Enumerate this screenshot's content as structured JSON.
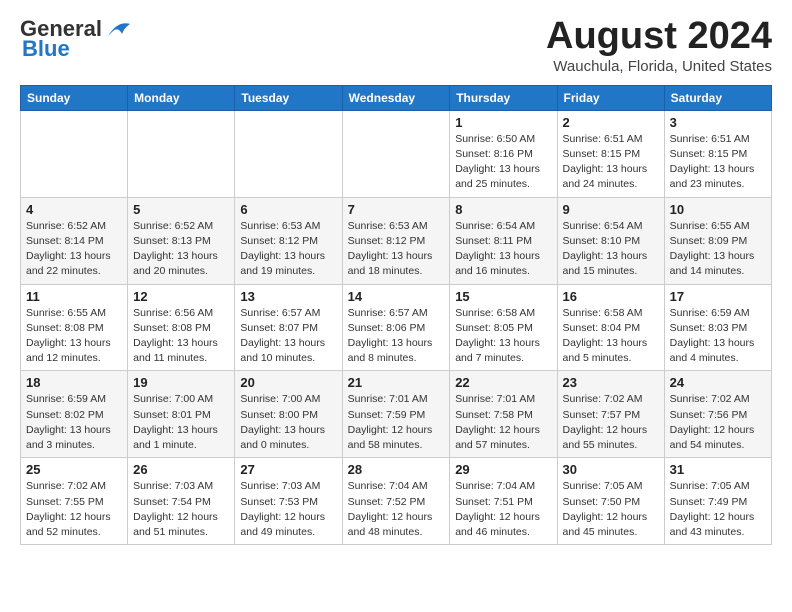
{
  "header": {
    "logo_general": "General",
    "logo_blue": "Blue",
    "month": "August 2024",
    "location": "Wauchula, Florida, United States"
  },
  "weekdays": [
    "Sunday",
    "Monday",
    "Tuesday",
    "Wednesday",
    "Thursday",
    "Friday",
    "Saturday"
  ],
  "weeks": [
    [
      {
        "day": "",
        "detail": ""
      },
      {
        "day": "",
        "detail": ""
      },
      {
        "day": "",
        "detail": ""
      },
      {
        "day": "",
        "detail": ""
      },
      {
        "day": "1",
        "detail": "Sunrise: 6:50 AM\nSunset: 8:16 PM\nDaylight: 13 hours\nand 25 minutes."
      },
      {
        "day": "2",
        "detail": "Sunrise: 6:51 AM\nSunset: 8:15 PM\nDaylight: 13 hours\nand 24 minutes."
      },
      {
        "day": "3",
        "detail": "Sunrise: 6:51 AM\nSunset: 8:15 PM\nDaylight: 13 hours\nand 23 minutes."
      }
    ],
    [
      {
        "day": "4",
        "detail": "Sunrise: 6:52 AM\nSunset: 8:14 PM\nDaylight: 13 hours\nand 22 minutes."
      },
      {
        "day": "5",
        "detail": "Sunrise: 6:52 AM\nSunset: 8:13 PM\nDaylight: 13 hours\nand 20 minutes."
      },
      {
        "day": "6",
        "detail": "Sunrise: 6:53 AM\nSunset: 8:12 PM\nDaylight: 13 hours\nand 19 minutes."
      },
      {
        "day": "7",
        "detail": "Sunrise: 6:53 AM\nSunset: 8:12 PM\nDaylight: 13 hours\nand 18 minutes."
      },
      {
        "day": "8",
        "detail": "Sunrise: 6:54 AM\nSunset: 8:11 PM\nDaylight: 13 hours\nand 16 minutes."
      },
      {
        "day": "9",
        "detail": "Sunrise: 6:54 AM\nSunset: 8:10 PM\nDaylight: 13 hours\nand 15 minutes."
      },
      {
        "day": "10",
        "detail": "Sunrise: 6:55 AM\nSunset: 8:09 PM\nDaylight: 13 hours\nand 14 minutes."
      }
    ],
    [
      {
        "day": "11",
        "detail": "Sunrise: 6:55 AM\nSunset: 8:08 PM\nDaylight: 13 hours\nand 12 minutes."
      },
      {
        "day": "12",
        "detail": "Sunrise: 6:56 AM\nSunset: 8:08 PM\nDaylight: 13 hours\nand 11 minutes."
      },
      {
        "day": "13",
        "detail": "Sunrise: 6:57 AM\nSunset: 8:07 PM\nDaylight: 13 hours\nand 10 minutes."
      },
      {
        "day": "14",
        "detail": "Sunrise: 6:57 AM\nSunset: 8:06 PM\nDaylight: 13 hours\nand 8 minutes."
      },
      {
        "day": "15",
        "detail": "Sunrise: 6:58 AM\nSunset: 8:05 PM\nDaylight: 13 hours\nand 7 minutes."
      },
      {
        "day": "16",
        "detail": "Sunrise: 6:58 AM\nSunset: 8:04 PM\nDaylight: 13 hours\nand 5 minutes."
      },
      {
        "day": "17",
        "detail": "Sunrise: 6:59 AM\nSunset: 8:03 PM\nDaylight: 13 hours\nand 4 minutes."
      }
    ],
    [
      {
        "day": "18",
        "detail": "Sunrise: 6:59 AM\nSunset: 8:02 PM\nDaylight: 13 hours\nand 3 minutes."
      },
      {
        "day": "19",
        "detail": "Sunrise: 7:00 AM\nSunset: 8:01 PM\nDaylight: 13 hours\nand 1 minute."
      },
      {
        "day": "20",
        "detail": "Sunrise: 7:00 AM\nSunset: 8:00 PM\nDaylight: 13 hours\nand 0 minutes."
      },
      {
        "day": "21",
        "detail": "Sunrise: 7:01 AM\nSunset: 7:59 PM\nDaylight: 12 hours\nand 58 minutes."
      },
      {
        "day": "22",
        "detail": "Sunrise: 7:01 AM\nSunset: 7:58 PM\nDaylight: 12 hours\nand 57 minutes."
      },
      {
        "day": "23",
        "detail": "Sunrise: 7:02 AM\nSunset: 7:57 PM\nDaylight: 12 hours\nand 55 minutes."
      },
      {
        "day": "24",
        "detail": "Sunrise: 7:02 AM\nSunset: 7:56 PM\nDaylight: 12 hours\nand 54 minutes."
      }
    ],
    [
      {
        "day": "25",
        "detail": "Sunrise: 7:02 AM\nSunset: 7:55 PM\nDaylight: 12 hours\nand 52 minutes."
      },
      {
        "day": "26",
        "detail": "Sunrise: 7:03 AM\nSunset: 7:54 PM\nDaylight: 12 hours\nand 51 minutes."
      },
      {
        "day": "27",
        "detail": "Sunrise: 7:03 AM\nSunset: 7:53 PM\nDaylight: 12 hours\nand 49 minutes."
      },
      {
        "day": "28",
        "detail": "Sunrise: 7:04 AM\nSunset: 7:52 PM\nDaylight: 12 hours\nand 48 minutes."
      },
      {
        "day": "29",
        "detail": "Sunrise: 7:04 AM\nSunset: 7:51 PM\nDaylight: 12 hours\nand 46 minutes."
      },
      {
        "day": "30",
        "detail": "Sunrise: 7:05 AM\nSunset: 7:50 PM\nDaylight: 12 hours\nand 45 minutes."
      },
      {
        "day": "31",
        "detail": "Sunrise: 7:05 AM\nSunset: 7:49 PM\nDaylight: 12 hours\nand 43 minutes."
      }
    ]
  ]
}
